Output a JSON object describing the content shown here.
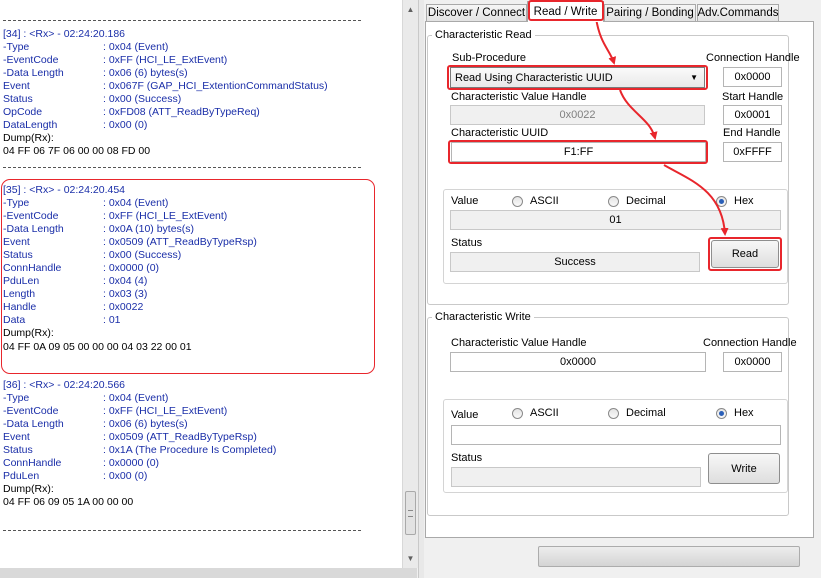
{
  "log": {
    "separator": "------------------------------------------------------------------------------------------",
    "entries": [
      {
        "header": "[34] : <Rx> - 02:24:20.186",
        "fields": [
          {
            "key": "-Type",
            "value": ": 0x04 (Event)"
          },
          {
            "key": "-EventCode",
            "value": ": 0xFF (HCI_LE_ExtEvent)"
          },
          {
            "key": "-Data Length",
            "value": ": 0x06 (6) bytes(s)"
          },
          {
            "key": " Event",
            "value": ": 0x067F (GAP_HCI_ExtentionCommandStatus)"
          },
          {
            "key": " Status",
            "value": ": 0x00 (Success)"
          },
          {
            "key": " OpCode",
            "value": ": 0xFD08 (ATT_ReadByTypeReq)"
          },
          {
            "key": " DataLength",
            "value": ": 0x00 (0)"
          }
        ],
        "dump_label": "Dump(Rx):",
        "dump": "04 FF 06 7F 06 00 00 08 FD 00"
      },
      {
        "header": "[35] : <Rx> - 02:24:20.454",
        "fields": [
          {
            "key": "-Type",
            "value": ": 0x04 (Event)"
          },
          {
            "key": "-EventCode",
            "value": ": 0xFF (HCI_LE_ExtEvent)"
          },
          {
            "key": "-Data Length",
            "value": ": 0x0A (10) bytes(s)"
          },
          {
            "key": " Event",
            "value": ": 0x0509 (ATT_ReadByTypeRsp)"
          },
          {
            "key": " Status",
            "value": ": 0x00 (Success)"
          },
          {
            "key": " ConnHandle",
            "value": ": 0x0000 (0)"
          },
          {
            "key": " PduLen",
            "value": ": 0x04 (4)"
          },
          {
            "key": " Length",
            "value": ": 0x03 (3)"
          },
          {
            "key": " Handle",
            "value": ": 0x0022"
          },
          {
            "key": " Data",
            "value": ": 01"
          }
        ],
        "dump_label": "Dump(Rx):",
        "dump": "04 FF 0A 09 05 00 00 00 04 03 22 00 01"
      },
      {
        "header": "[36] : <Rx> - 02:24:20.566",
        "fields": [
          {
            "key": "-Type",
            "value": ": 0x04 (Event)"
          },
          {
            "key": "-EventCode",
            "value": ": 0xFF (HCI_LE_ExtEvent)"
          },
          {
            "key": "-Data Length",
            "value": ": 0x06 (6) bytes(s)"
          },
          {
            "key": " Event",
            "value": ": 0x0509 (ATT_ReadByTypeRsp)"
          },
          {
            "key": " Status",
            "value": ": 0x1A (The Procedure Is Completed)"
          },
          {
            "key": " ConnHandle",
            "value": ": 0x0000 (0)"
          },
          {
            "key": " PduLen",
            "value": ": 0x00 (0)"
          }
        ],
        "dump_label": "Dump(Rx):",
        "dump": "04 FF 06 09 05 1A 00 00 00"
      }
    ]
  },
  "tabs": [
    {
      "label": "Discover / Connect"
    },
    {
      "label": "Read / Write"
    },
    {
      "label": "Pairing / Bonding"
    },
    {
      "label": "Adv.Commands"
    }
  ],
  "char_read": {
    "title": "Characteristic Read",
    "sub_procedure_label": "Sub-Procedure",
    "sub_procedure_value": "Read Using Characteristic UUID",
    "conn_handle_label": "Connection Handle",
    "conn_handle_value": "0x0000",
    "value_handle_label": "Characteristic Value Handle",
    "value_handle_value": "0x0022",
    "start_handle_label": "Start Handle",
    "start_handle_value": "0x0001",
    "uuid_label": "Characteristic UUID",
    "uuid_value": "F1:FF",
    "end_handle_label": "End Handle",
    "end_handle_value": "0xFFFF",
    "value_label": "Value",
    "radio_ascii": "ASCII",
    "radio_decimal": "Decimal",
    "radio_hex": "Hex",
    "value_output": "01",
    "status_label": "Status",
    "status_value": "Success",
    "read_button": "Read"
  },
  "char_write": {
    "title": "Characteristic Write",
    "value_handle_label": "Characteristic Value Handle",
    "value_handle_value": "0x0000",
    "conn_handle_label": "Connection Handle",
    "conn_handle_value": "0x0000",
    "value_label": "Value",
    "radio_ascii": "ASCII",
    "radio_decimal": "Decimal",
    "radio_hex": "Hex",
    "value_input": "",
    "status_label": "Status",
    "status_value": "",
    "write_button": "Write"
  },
  "colors": {
    "highlight": "#e8262c",
    "log_text": "#1a2ea8",
    "radio_selected": "#2a5fb8"
  }
}
